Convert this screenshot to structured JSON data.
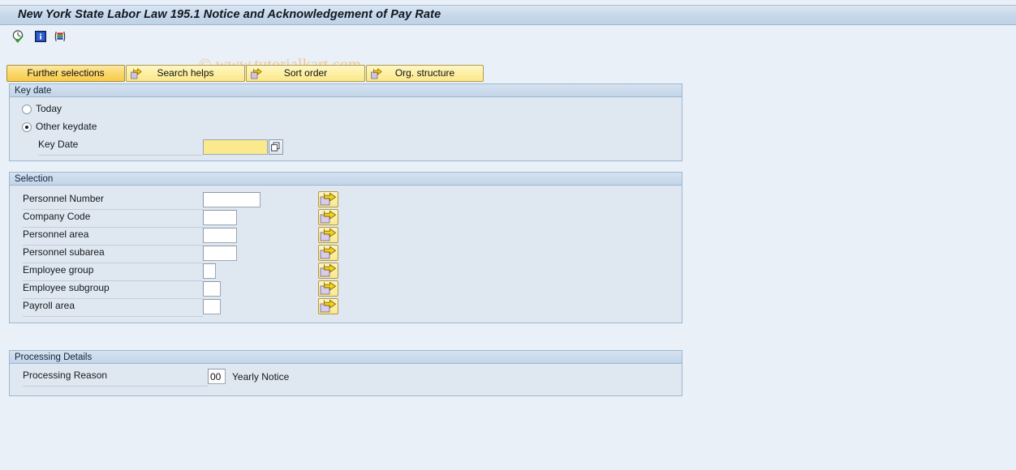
{
  "window": {
    "title": "New York State Labor Law 195.1 Notice and Acknowledgement of Pay Rate"
  },
  "watermark": {
    "text": "© www.tutorialkart.com"
  },
  "toolbar": {
    "icons": [
      {
        "name": "execute-clock-icon",
        "title": "Execute"
      },
      {
        "name": "info-icon",
        "title": "Information"
      },
      {
        "name": "variant-stripes-icon",
        "title": "Get Variant"
      }
    ]
  },
  "buttons": [
    {
      "label": "Further selections",
      "active": true,
      "has_arrow": false
    },
    {
      "label": "Search helps",
      "active": false,
      "has_arrow": true
    },
    {
      "label": "Sort order",
      "active": false,
      "has_arrow": true
    },
    {
      "label": "Org. structure",
      "active": false,
      "has_arrow": true
    }
  ],
  "key_date_panel": {
    "header": "Key date",
    "options": [
      {
        "label": "Today",
        "selected": false
      },
      {
        "label": "Other keydate",
        "selected": true
      }
    ],
    "key_date_field": {
      "label": "Key Date",
      "value": "",
      "placeholder": ""
    }
  },
  "selection_panel": {
    "header": "Selection",
    "rows": [
      {
        "label": "Personnel Number",
        "value": "",
        "placeholder": ""
      },
      {
        "label": "Company Code",
        "value": "",
        "placeholder": ""
      },
      {
        "label": "Personnel area",
        "value": "",
        "placeholder": ""
      },
      {
        "label": "Personnel subarea",
        "value": "",
        "placeholder": ""
      },
      {
        "label": "Employee group",
        "value": "",
        "placeholder": ""
      },
      {
        "label": "Employee subgroup",
        "value": "",
        "placeholder": ""
      },
      {
        "label": "Payroll area",
        "value": "",
        "placeholder": ""
      }
    ]
  },
  "processing_panel": {
    "header": "Processing Details",
    "reason": {
      "label": "Processing Reason",
      "value": "00",
      "description": "Yearly Notice"
    }
  },
  "colors": {
    "page_background": "#e9f0f7",
    "panel_background": "#dfe8f1",
    "panel_border": "#9db7d2",
    "button_yellow": "#fbe88d",
    "button_yellow_active": "#f8cb4a",
    "required_field": "#fbe98e",
    "watermark": "#f0c694"
  }
}
